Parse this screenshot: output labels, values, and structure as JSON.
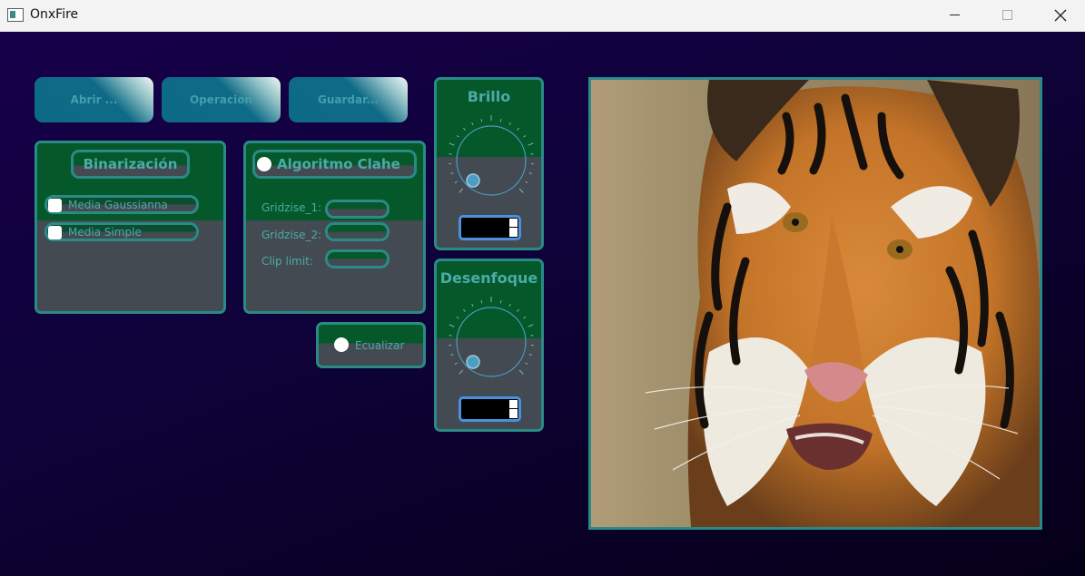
{
  "window": {
    "title": "OnxFire"
  },
  "toolbar": {
    "open_label": "Abrir ...",
    "operation_label": "Operacion",
    "save_label": "Guardar..."
  },
  "binarization": {
    "title": "Binarización",
    "options": [
      {
        "label": "Media Gaussianna",
        "checked": false
      },
      {
        "label": "Media Simple",
        "checked": false
      }
    ]
  },
  "clahe": {
    "title": "Algoritmo Clahe",
    "selected": false,
    "fields": [
      {
        "label": "Gridzise_1:",
        "value": ""
      },
      {
        "label": "Gridzise_2:",
        "value": ""
      },
      {
        "label": "Clip limit:",
        "value": ""
      }
    ]
  },
  "equalize": {
    "label": "Ecualizar",
    "selected": false
  },
  "brightness": {
    "title": "Brillo",
    "value": ""
  },
  "blur": {
    "title": "Desenfoque",
    "value": ""
  },
  "image": {
    "subject": "tiger",
    "icon": "tiger-photo"
  },
  "colors": {
    "accent": "#2a8a86",
    "text": "#4aaba8",
    "panel_green": "#055829",
    "panel_gray": "#444a52",
    "button": "#0d6a86",
    "background": "#0c0030"
  }
}
